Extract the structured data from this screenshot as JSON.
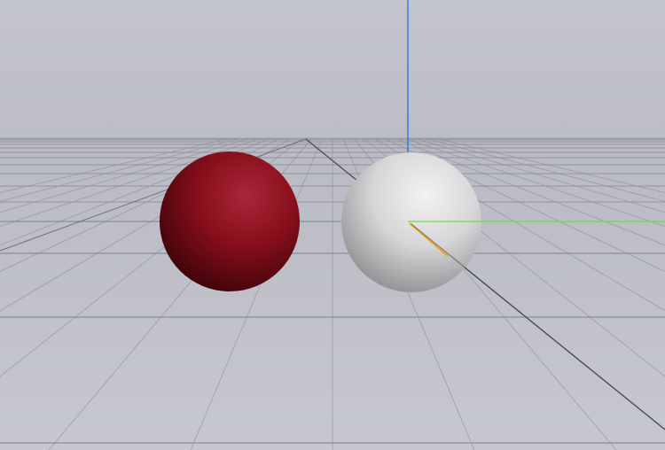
{
  "viewport": {
    "background_color": "#bfc0c9",
    "sky_color": "#bdbec8",
    "ground_color": "#c2c3cb",
    "grid_color": "#8a8b93",
    "grid_major_color": "#6f7077"
  },
  "scene": {
    "objects": [
      {
        "name": "red-sphere",
        "color": "#8a0f1c",
        "highlight": "#b0333f",
        "shadow": "#3a0308"
      },
      {
        "name": "white-sphere",
        "color": "#d9d9da",
        "highlight": "#efefef",
        "shadow": "#8e8e90"
      }
    ],
    "axes": {
      "x_color": "#f0a020",
      "y_color": "#7fe05a",
      "z_color": "#2f7fe0"
    }
  }
}
